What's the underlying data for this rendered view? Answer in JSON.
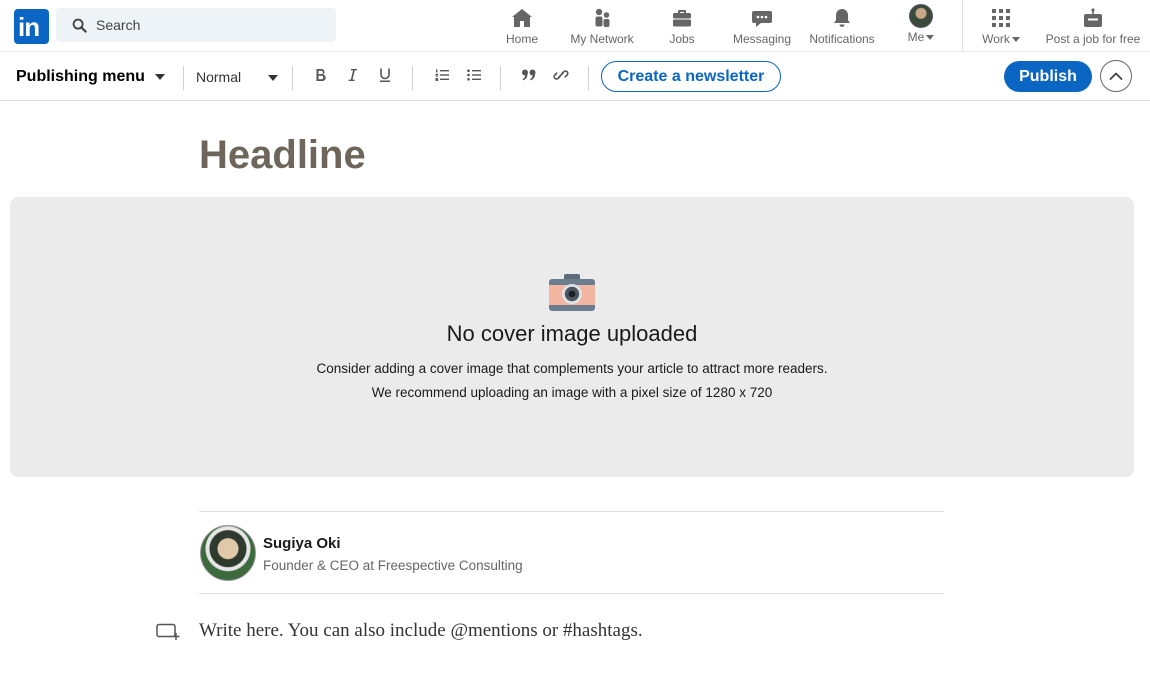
{
  "nav": {
    "logo_text": "in",
    "search_placeholder": "Search",
    "items": [
      {
        "label": "Home",
        "icon": "home-icon"
      },
      {
        "label": "My Network",
        "icon": "people-icon"
      },
      {
        "label": "Jobs",
        "icon": "briefcase-icon"
      },
      {
        "label": "Messaging",
        "icon": "chat-icon"
      },
      {
        "label": "Notifications",
        "icon": "bell-icon"
      },
      {
        "label": "Me",
        "icon": "avatar"
      },
      {
        "label": "Work",
        "icon": "grid-icon"
      },
      {
        "label": "Post a job for free",
        "icon": "post-job-icon"
      }
    ]
  },
  "toolbar": {
    "publishing_menu": "Publishing menu",
    "text_style": "Normal",
    "newsletter_label": "Create a newsletter",
    "publish_label": "Publish"
  },
  "editor": {
    "headline_placeholder": "Headline",
    "cover": {
      "title": "No cover image uploaded",
      "line1": "Consider adding a cover image that complements your article to attract more readers.",
      "line2": "We recommend uploading an image with a pixel size of 1280 x 720"
    },
    "author": {
      "name": "Sugiya Oki",
      "title": "Founder & CEO at Freespective Consulting"
    },
    "body_placeholder": "Write here. You can also include @mentions or #hashtags."
  },
  "colors": {
    "brand": "#0a66c2",
    "headline_placeholder": "#6e665b",
    "cover_background": "#ebebeb"
  }
}
